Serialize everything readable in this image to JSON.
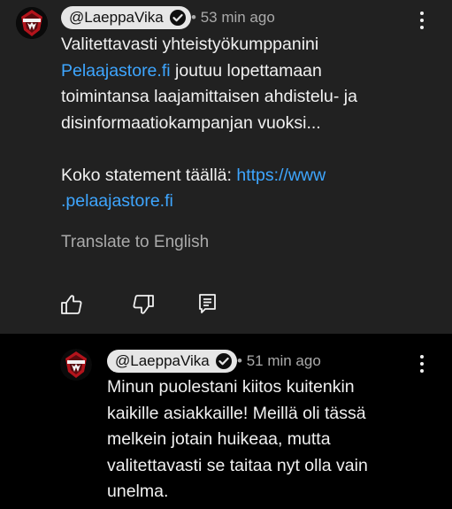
{
  "comment": {
    "author": "@LaeppaVika",
    "time": "53 min ago",
    "separator": "•",
    "text": {
      "line1": "Valitettavasti yhteistyökumppanini",
      "line2_link": "Pelaajastore.fi",
      "line2_rest": " joutuu lopettamaan",
      "line3": "toimintansa laajamittaisen ahdistelu- ja",
      "line4": "disinformaatiokampanjan vuoksi...",
      "line6_prefix": "Koko statement täällä: ",
      "link_part1": "https://www",
      "link_part2": ".pelaajastore.fi"
    },
    "translate_label": "Translate to English",
    "actions": [
      "thumb-up-icon",
      "thumb-down-icon",
      "reply-icon"
    ]
  },
  "reply": {
    "author": "@LaeppaVika",
    "time": "51 min ago",
    "separator": "•",
    "lines": [
      "Minun puolestani kiitos kuitenkin",
      "kaikille asiakkaille! Meillä oli tässä",
      "melkein jotain huikeaa, mutta",
      "valitettavasti se taitaa nyt olla vain",
      "unelma."
    ]
  },
  "colors": {
    "comment_bg": "#212121",
    "reply_bg": "#000000",
    "link": "#3ea6ff",
    "secondary_text": "#aaaaaa"
  }
}
